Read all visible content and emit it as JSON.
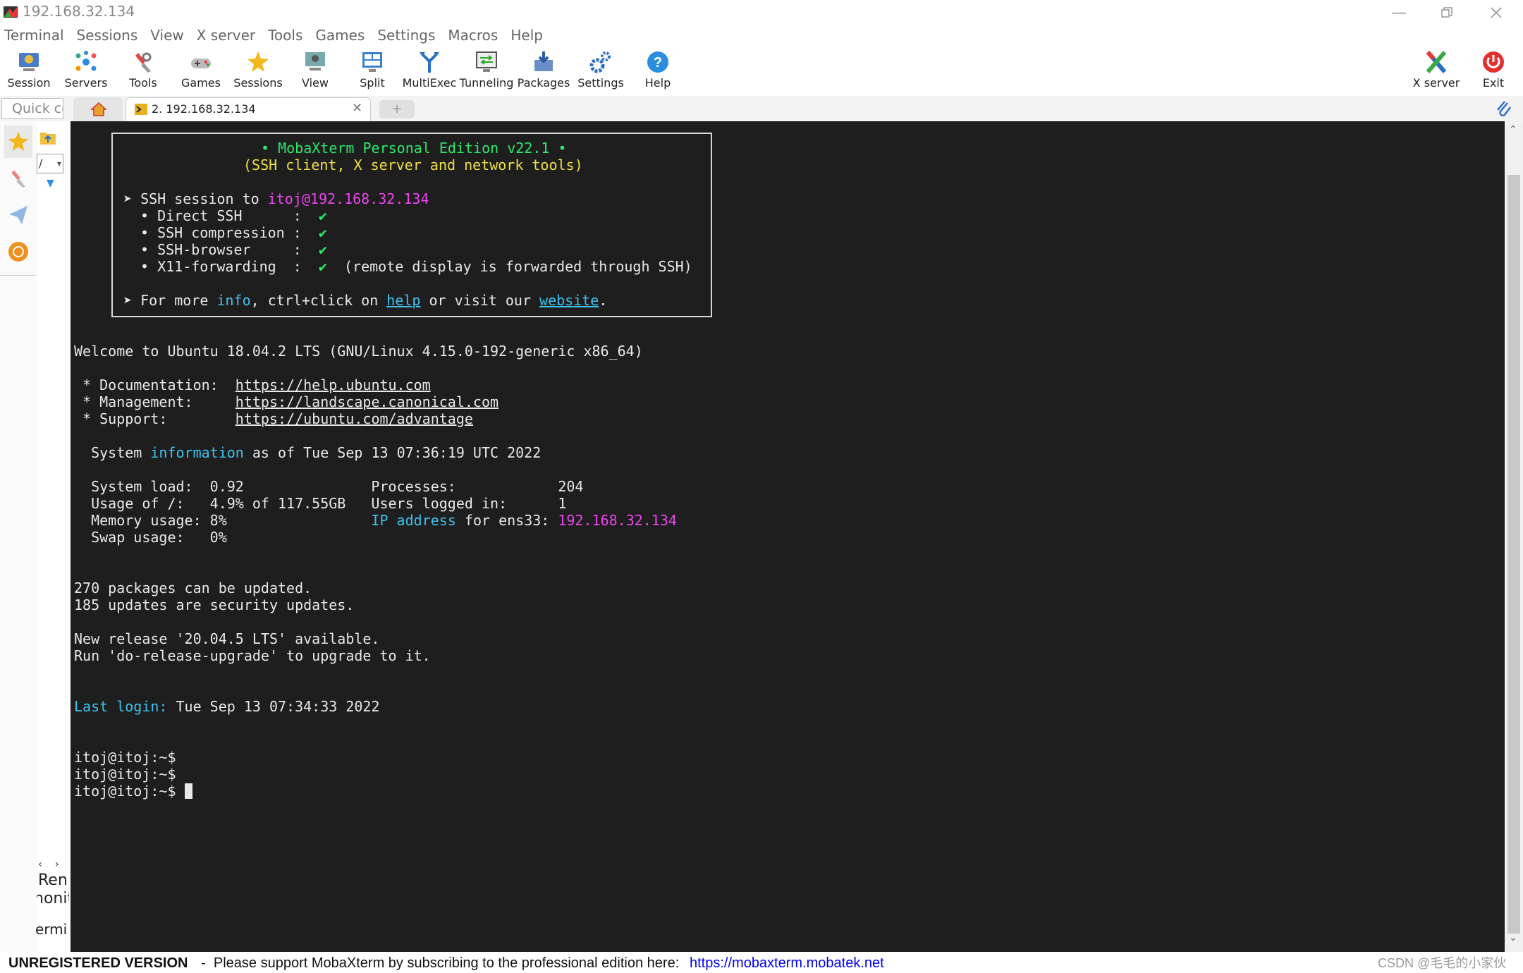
{
  "window": {
    "title": "192.168.32.134"
  },
  "menu": [
    "Terminal",
    "Sessions",
    "View",
    "X server",
    "Tools",
    "Games",
    "Settings",
    "Macros",
    "Help"
  ],
  "toolbar": {
    "left": [
      {
        "label": "Session",
        "icon": "session-icon"
      },
      {
        "label": "Servers",
        "icon": "servers-icon"
      },
      {
        "label": "Tools",
        "icon": "tools-icon"
      },
      {
        "label": "Games",
        "icon": "games-icon"
      },
      {
        "label": "Sessions",
        "icon": "star-icon"
      },
      {
        "label": "View",
        "icon": "view-icon"
      },
      {
        "label": "Split",
        "icon": "split-icon"
      },
      {
        "label": "MultiExec",
        "icon": "multiexec-icon"
      },
      {
        "label": "Tunneling",
        "icon": "tunneling-icon"
      },
      {
        "label": "Packages",
        "icon": "packages-icon"
      },
      {
        "label": "Settings",
        "icon": "settings-icon"
      },
      {
        "label": "Help",
        "icon": "help-icon"
      }
    ],
    "right": [
      {
        "label": "X server",
        "icon": "xserver-icon"
      },
      {
        "label": "Exit",
        "icon": "power-icon"
      }
    ]
  },
  "quick_connect": {
    "placeholder": "Quick connect..."
  },
  "tabs": {
    "session_label": "2. 192.168.32.134"
  },
  "sidepanel": {
    "path_value": "/",
    "labels": [
      "Ren",
      "nonit",
      "ermi"
    ]
  },
  "terminal": {
    "banner": {
      "title": "• MobaXterm Personal Edition v22.1 •",
      "subtitle": "(SSH client, X server and network tools)",
      "session_prefix": "➤ SSH session to ",
      "session_target": "itoj@192.168.32.134",
      "features": [
        {
          "name": "• Direct SSH      :  ",
          "check": "✔",
          "note": ""
        },
        {
          "name": "• SSH compression :  ",
          "check": "✔",
          "note": ""
        },
        {
          "name": "• SSH-browser     :  ",
          "check": "✔",
          "note": ""
        },
        {
          "name": "• X11-forwarding  :  ",
          "check": "✔",
          "note": "  (remote display is forwarded through SSH)"
        }
      ],
      "more_prefix": "➤ For more ",
      "info": "info",
      "more_mid": ", ctrl+click on ",
      "help": "help",
      "more_mid2": " or visit our ",
      "website": "website",
      "more_end": "."
    },
    "welcome": "Welcome to Ubuntu 18.04.2 LTS (GNU/Linux 4.15.0-192-generic x86_64)",
    "links": [
      {
        "label": " * Documentation:  ",
        "url": "https://help.ubuntu.com"
      },
      {
        "label": " * Management:     ",
        "url": "https://landscape.canonical.com"
      },
      {
        "label": " * Support:        ",
        "url": "https://ubuntu.com/advantage"
      }
    ],
    "sysinfo_prefix": "  System ",
    "sysinfo_word": "information",
    "sysinfo_suffix": " as of Tue Sep 13 07:36:19 UTC 2022",
    "stats_rows": [
      "  System load:  0.92               Processes:            204",
      "  Usage of /:   4.9% of 117.55GB   Users logged in:      1"
    ],
    "memory_prefix": "  Memory usage: 8%                 ",
    "ip_label": "IP address",
    "ip_mid": " for ens33: ",
    "ip_value": "192.168.32.134",
    "swap": "  Swap usage:   0%",
    "updates": [
      "270 packages can be updated.",
      "185 updates are security updates."
    ],
    "release": [
      "New release '20.04.5 LTS' available.",
      "Run 'do-release-upgrade' to upgrade to it."
    ],
    "last_login_label": "Last login:",
    "last_login_value": " Tue Sep 13 07:34:33 2022",
    "prompt": "itoj@itoj:~$ "
  },
  "status": {
    "unregistered": "UNREGISTERED VERSION",
    "message": "  -  Please support MobaXterm by subscribing to the professional edition here:  ",
    "link": "https://mobaxterm.mobatek.net",
    "watermark": "CSDN @毛毛的小家伙"
  },
  "colors": {
    "terminal_bg": "#1e1e1e",
    "green": "#2de86c",
    "yellow": "#f0e040",
    "magenta": "#ee44ee",
    "cyan": "#3ec2f0",
    "link_blue": "#0000ee"
  }
}
